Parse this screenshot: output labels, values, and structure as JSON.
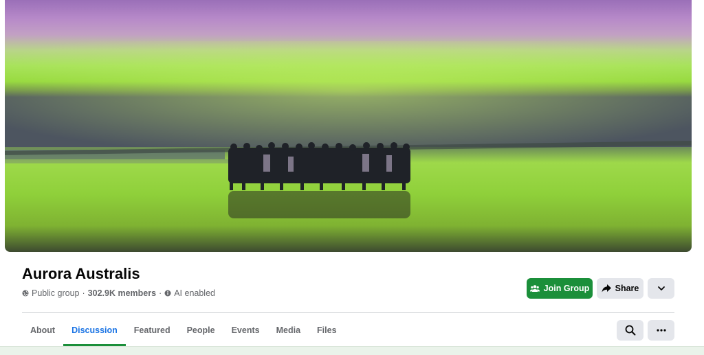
{
  "group": {
    "name": "Aurora Australis",
    "privacy": "Public group",
    "separator": "·",
    "members": "302.9K members",
    "ai": "AI enabled"
  },
  "actions": {
    "join_label": "Join Group",
    "share_label": "Share"
  },
  "tabs": [
    {
      "label": "About"
    },
    {
      "label": "Discussion"
    },
    {
      "label": "Featured"
    },
    {
      "label": "People"
    },
    {
      "label": "Events"
    },
    {
      "label": "Media"
    },
    {
      "label": "Files"
    }
  ],
  "active_tab": "Discussion",
  "colors": {
    "join_button": "#1b8f3a",
    "active_tab_text": "#1b74e4",
    "secondary_button": "#e4e6eb",
    "aurora_green": "#9be03a",
    "aurora_purple": "#a47bc8"
  },
  "icons": {
    "privacy": "globe-icon",
    "ai": "info-icon",
    "join": "group-icon",
    "share": "share-arrow-icon",
    "more": "chevron-down-icon",
    "search": "search-icon",
    "options": "ellipsis-icon"
  }
}
